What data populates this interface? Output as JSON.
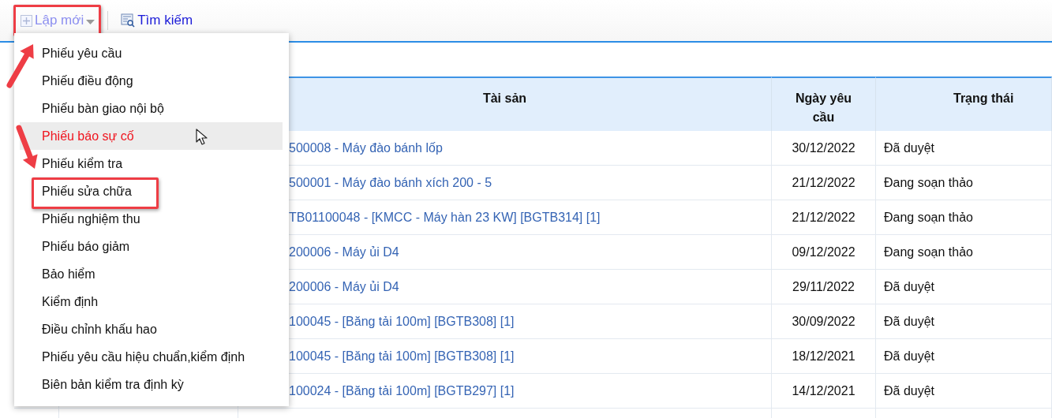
{
  "toolbar": {
    "new_button": {
      "label": "Lập mới",
      "framed": true
    },
    "search_button": {
      "label": "Tìm kiếm"
    }
  },
  "new_menu": {
    "items": [
      {
        "label": "Phiếu yêu cầu",
        "hovered": false,
        "framed": false
      },
      {
        "label": "Phiếu điều động",
        "hovered": false,
        "framed": false
      },
      {
        "label": "Phiếu bàn giao nội bộ",
        "hovered": false,
        "framed": false
      },
      {
        "label": "Phiếu báo sự cố",
        "hovered": true,
        "framed": false
      },
      {
        "label": "Phiếu kiểm tra",
        "hovered": false,
        "framed": false
      },
      {
        "label": "Phiếu sửa chữa",
        "hovered": false,
        "framed": true
      },
      {
        "label": "Phiếu nghiệm thu",
        "hovered": false,
        "framed": false
      },
      {
        "label": "Phiếu báo giảm",
        "hovered": false,
        "framed": false
      },
      {
        "label": "Bảo hiểm",
        "hovered": false,
        "framed": false
      },
      {
        "label": "Kiểm định",
        "hovered": false,
        "framed": false
      },
      {
        "label": "Điều chỉnh khấu hao",
        "hovered": false,
        "framed": false
      },
      {
        "label": "Phiếu yêu cầu hiệu chuẩn,kiểm định",
        "hovered": false,
        "framed": false
      },
      {
        "label": "Biên bản kiểm tra định kỳ",
        "hovered": false,
        "framed": false
      }
    ]
  },
  "table": {
    "columns": [
      "Tài sản",
      "Ngày yêu cầu",
      "Trạng thái"
    ],
    "rows": [
      {
        "asset": "500008 - Máy đào bánh lốp",
        "date": "30/12/2022",
        "status": "Đã duyệt"
      },
      {
        "asset": "500001 - Máy đào bánh xích 200 - 5",
        "date": "21/12/2022",
        "status": "Đang soạn thảo"
      },
      {
        "asset": "TB01100048 - [KMCC - Máy hàn 23 KW] [BGTB314] [1]",
        "date": "21/12/2022",
        "status": "Đang soạn thảo"
      },
      {
        "asset": "200006 - Máy ủi D4",
        "date": "09/12/2022",
        "status": "Đang soạn thảo"
      },
      {
        "asset": "200006 - Máy ủi D4",
        "date": "29/11/2022",
        "status": "Đã duyệt"
      },
      {
        "asset": "100045 - [Băng tải 100m] [BGTB308] [1]",
        "date": "30/09/2022",
        "status": "Đã duyệt"
      },
      {
        "asset": "100045 - [Băng tải 100m] [BGTB308] [1]",
        "date": "18/12/2021",
        "status": "Đã duyệt"
      },
      {
        "asset": "100024 - [Băng tải 100m] [BGTB297] [1]",
        "date": "14/12/2021",
        "status": "Đã duyệt"
      }
    ]
  }
}
